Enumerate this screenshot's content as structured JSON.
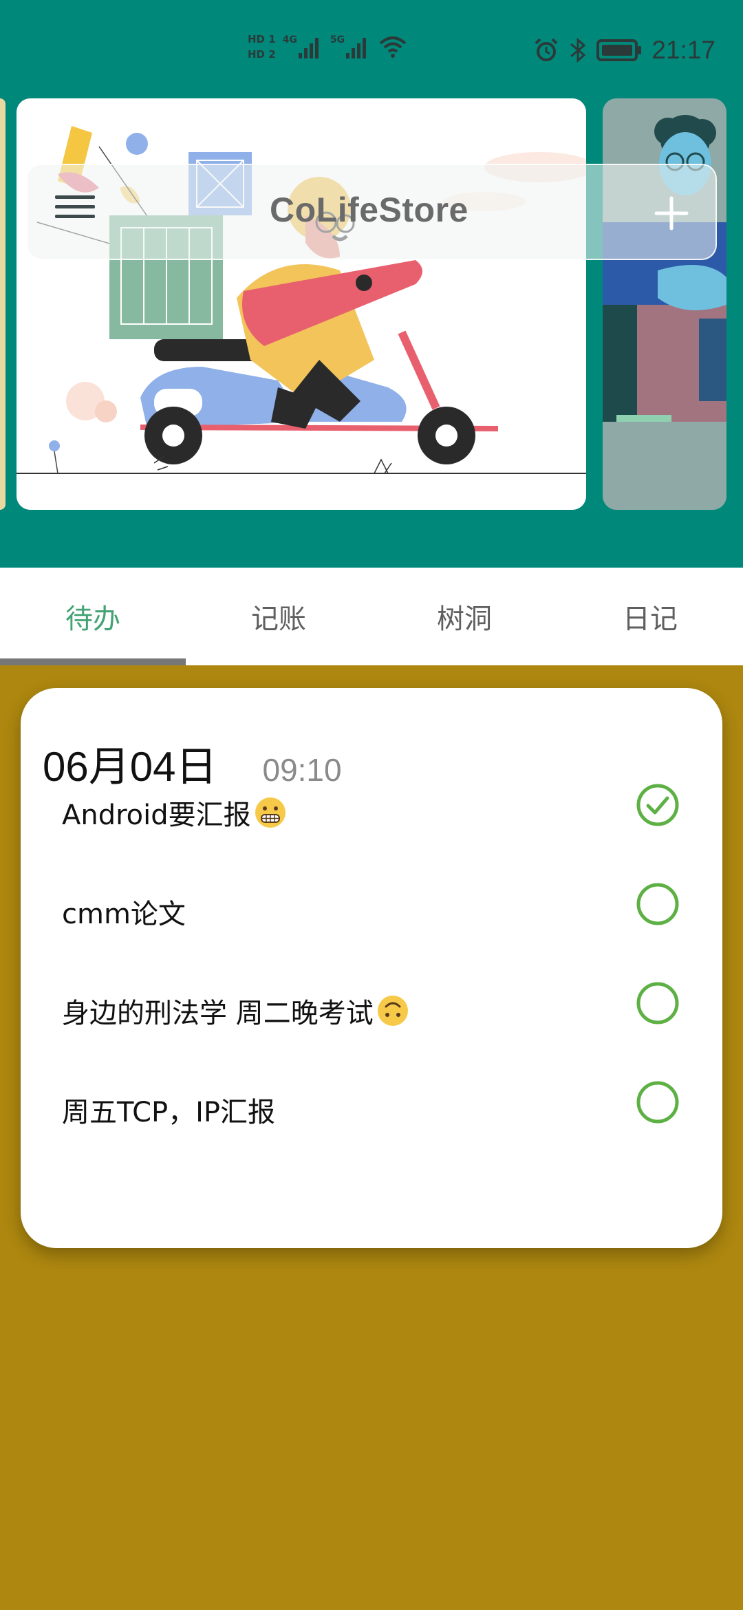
{
  "status_bar": {
    "hd1": "HD 1",
    "hd2": "HD 2",
    "network": "4G",
    "network2": "5G",
    "time": "21:17"
  },
  "app": {
    "title": "CoLifeStore",
    "menu_icon": "hamburger-menu-icon",
    "add_icon": "plus-icon"
  },
  "tabs": [
    {
      "label": "待办",
      "active": true
    },
    {
      "label": "记账",
      "active": false
    },
    {
      "label": "树洞",
      "active": false
    },
    {
      "label": "日记",
      "active": false
    }
  ],
  "todo_card": {
    "date": "06月04日",
    "time": "09:10",
    "items": [
      {
        "text": "Android要汇报",
        "emoji": "grimacing-face",
        "done": true
      },
      {
        "text": "cmm论文",
        "emoji": "",
        "done": false
      },
      {
        "text": "身边的刑法学 周二晚考试",
        "emoji": "upside-down-face",
        "done": false
      },
      {
        "text": "周五TCP，IP汇报",
        "emoji": "",
        "done": false
      }
    ]
  },
  "colors": {
    "header_bg": "#00897b",
    "body_bg": "#ad870f",
    "tab_active": "#43a373",
    "check_green": "#5db043"
  }
}
